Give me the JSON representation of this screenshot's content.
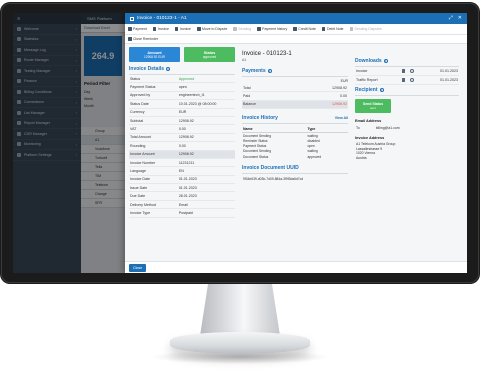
{
  "background_app": {
    "brand": "SMS Platform",
    "nav_items": [
      "Welcome",
      "Statistics",
      "Message Log",
      "Route Manager",
      "Testing Manager",
      "Finance",
      "Billing Conditions",
      "Connections",
      "List Manager",
      "Report Manager",
      "CDR Manager",
      "Monitoring",
      "Platform Settings"
    ],
    "panel_tab": "Download Excel",
    "tile_value": "264.9",
    "filter_title": "Period Filter",
    "filter_rows": [
      "Day",
      "Week",
      "Month"
    ],
    "list_items": [
      "Group",
      "A1",
      "Vodafone",
      "Turkcell",
      "Telia",
      "TIM",
      "Telekom",
      "Orange",
      "SFR"
    ]
  },
  "modal": {
    "title": "Invoice - 010123-1 - A1",
    "toolbar": [
      {
        "label": "Payment",
        "disabled": false
      },
      {
        "label": "Invoice",
        "disabled": false
      },
      {
        "label": "Invoice",
        "disabled": false
      },
      {
        "label": "Move to Dispute",
        "disabled": false
      },
      {
        "label": "Sending",
        "disabled": true
      },
      {
        "label": "Payment history",
        "disabled": false
      },
      {
        "label": "Credit Note",
        "disabled": false
      },
      {
        "label": "Debit Note",
        "disabled": false
      },
      {
        "label": "Sending Disputes",
        "disabled": true
      }
    ],
    "toolbar2_label": "Close Reminder",
    "amount_btn": {
      "line1": "Amount",
      "line2": "12908.92 EUR"
    },
    "status_btn": {
      "line1": "Status",
      "line2": "approved"
    },
    "invoice_details_title": "Invoice Details",
    "details": [
      {
        "k": "Status",
        "v": "Approved",
        "green": true
      },
      {
        "k": "Payment Status",
        "v": "open"
      },
      {
        "k": "Approved by",
        "v": "engineertech_t1"
      },
      {
        "k": "Status Date",
        "v": "10.01.2023 @ 08:00:00"
      },
      {
        "k": "Currency",
        "v": "EUR"
      },
      {
        "k": "Subtotal",
        "v": "12908.92"
      },
      {
        "k": "VAT",
        "v": "0.00"
      },
      {
        "k": "Total Amount",
        "v": "12908.92"
      },
      {
        "k": "Rounding",
        "v": "0.00"
      },
      {
        "k": "Invoice Amount",
        "v": "12908.92",
        "hl": true
      },
      {
        "k": "Invoice Number",
        "v": "11231211"
      },
      {
        "k": "Language",
        "v": "EN"
      },
      {
        "k": "Invoice Date",
        "v": "01.01.2023"
      },
      {
        "k": "Issue Date",
        "v": "01.01.2023"
      },
      {
        "k": "Due Date",
        "v": "28.01.2023"
      },
      {
        "k": "Delivery Method",
        "v": "Email"
      },
      {
        "k": "Invoice Type",
        "v": "Postpaid"
      }
    ],
    "invoice_heading": "Invoice - 010123-1",
    "invoice_sub": "A1",
    "payments": {
      "title": "Payments",
      "currency": "EUR",
      "rows": [
        {
          "k": "Total",
          "v": "12908.92"
        },
        {
          "k": "Paid",
          "v": "0.00"
        },
        {
          "k": "Balance",
          "v": "12908.92"
        }
      ]
    },
    "history": {
      "title": "Invoice History",
      "view_all": "View All",
      "col_name": "Name",
      "col_type": "Type",
      "rows": [
        {
          "n": "Document Sending",
          "t": "waiting"
        },
        {
          "n": "Reminder Status",
          "t": "disabled"
        },
        {
          "n": "Payment Status",
          "t": "open"
        },
        {
          "n": "Document Sending",
          "t": "waiting"
        },
        {
          "n": "Document Status",
          "t": "approved"
        }
      ]
    },
    "uuid": {
      "title": "Invoice Document UUID",
      "value": "9f34e639-d03b-7d09-884a-3f9f3da6d7cd"
    },
    "downloads": {
      "title": "Downloads",
      "rows": [
        {
          "n": "Invoice",
          "d": "01.01.2023"
        },
        {
          "n": "Traffic Report",
          "d": "01.01.2023"
        }
      ]
    },
    "recipient": {
      "title": "Recipient",
      "send_btn": {
        "line1": "Send Status",
        "line2": "sent"
      },
      "email_label": "Email Address",
      "email_to": "To",
      "email_value": "billing@a1.com",
      "addr_label": "Invoice Address",
      "addr_lines": [
        "A1 Telekom Austria Group",
        "Lassallestrasse 9",
        "1020 Vienna",
        "Austria"
      ]
    },
    "close_label": "Close"
  }
}
